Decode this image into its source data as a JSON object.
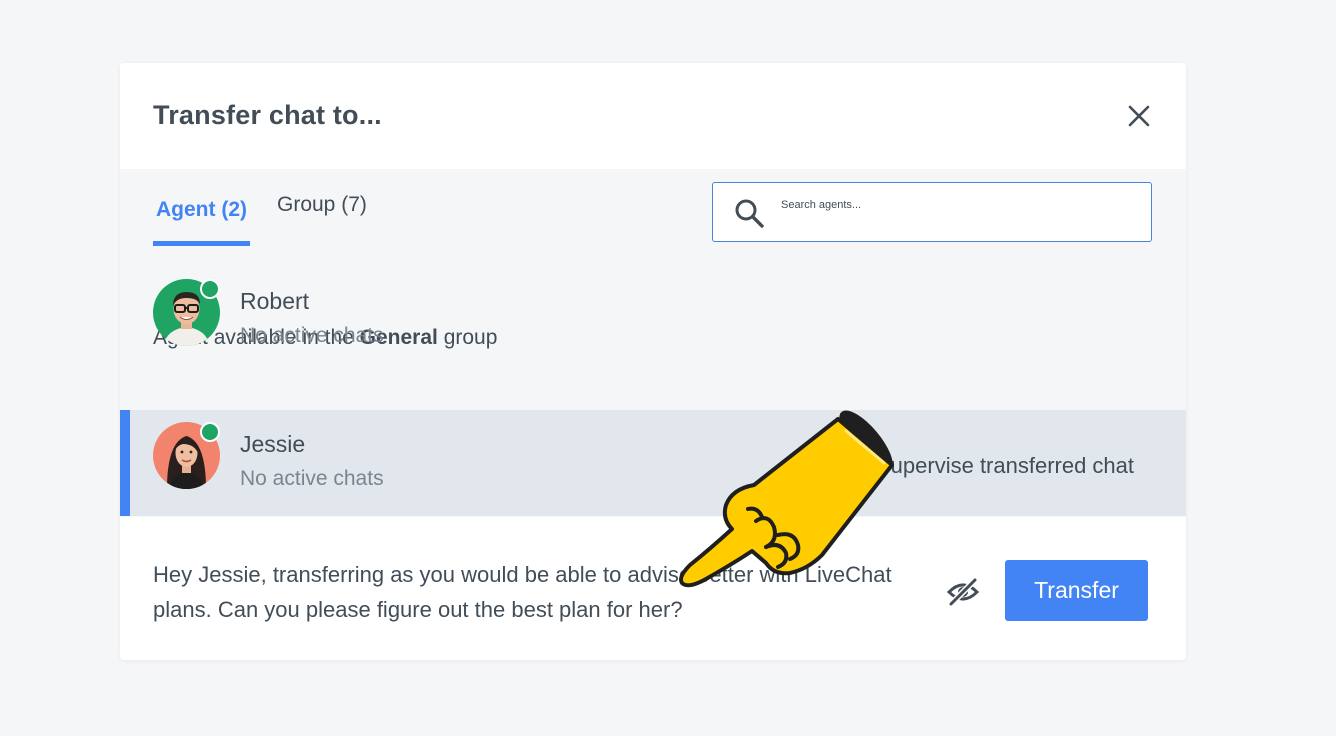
{
  "dialog": {
    "title": "Transfer chat to...",
    "close_icon": "close-icon"
  },
  "tabs": [
    {
      "label": "Agent (2)",
      "active": true
    },
    {
      "label": "Group (7)",
      "active": false
    }
  ],
  "search": {
    "placeholder": "Search agents...",
    "icon": "search-icon"
  },
  "info": {
    "prefix": "Agent available in the ",
    "group": "General",
    "suffix": " group"
  },
  "agents": [
    {
      "name": "Robert",
      "status": "No active chats",
      "online": true,
      "selected": false
    },
    {
      "name": "Jessie",
      "status": "No active chats",
      "online": true,
      "selected": true
    }
  ],
  "supervise": {
    "label": "Supervise transferred chat",
    "checked": true
  },
  "message": {
    "text": "Hey Jessie, transferring as you would be able to advise better with LiveChat plans. Can you please figure out the best plan for her?"
  },
  "actions": {
    "visibility_icon": "eye-slash-icon",
    "transfer_label": "Transfer"
  },
  "colors": {
    "accent": "#4384f5",
    "online": "#1fa463",
    "selected_row": "#e1e7ec",
    "panel": "#f5f6f8"
  }
}
